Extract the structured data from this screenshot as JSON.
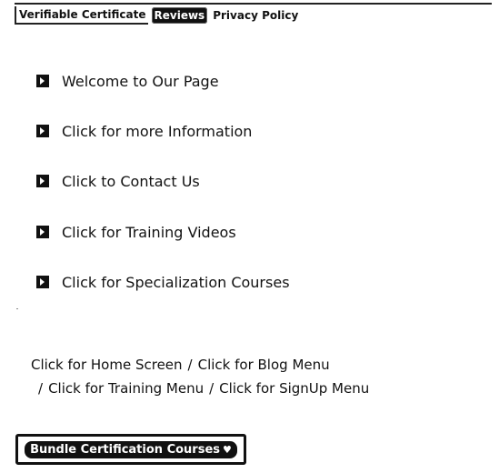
{
  "topnav": {
    "tabs": [
      {
        "label": "Verifiable Certificate"
      },
      {
        "label": "Reviews"
      },
      {
        "label": "Privacy Policy"
      }
    ]
  },
  "menu": {
    "items": [
      {
        "label": "Welcome to Our Page"
      },
      {
        "label": "Click for more Information"
      },
      {
        "label": "Click to Contact Us"
      },
      {
        "label": "Click for Training Videos"
      },
      {
        "label": "Click for Specialization Courses"
      }
    ]
  },
  "footer": {
    "links": [
      {
        "label": "Click for Home Screen"
      },
      {
        "label": "Click for Blog Menu"
      },
      {
        "label": "Click for Training Menu"
      },
      {
        "label": "Click for SignUp Menu"
      }
    ],
    "separator": "/"
  },
  "bundle_button": {
    "label": "Bundle Certification Courses",
    "icon": "heart-icon"
  }
}
